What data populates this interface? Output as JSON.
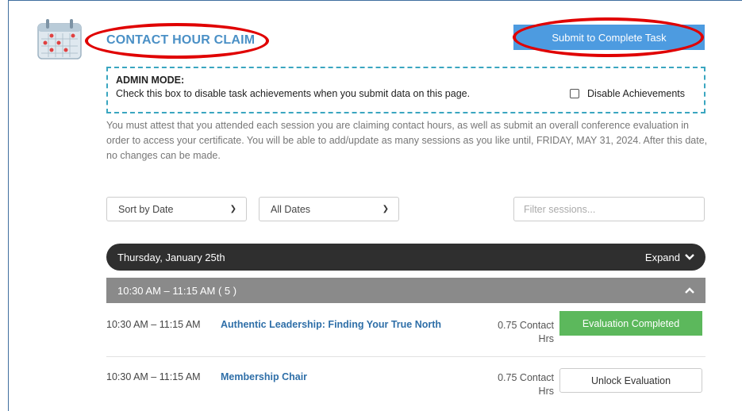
{
  "header": {
    "title": "CONTACT HOUR CLAIM",
    "submit_label": "Submit to Complete Task"
  },
  "admin": {
    "title": "ADMIN MODE:",
    "instruction": "Check this box to disable task achievements when you submit data on this page.",
    "checkbox_label": "Disable Achievements",
    "checked": false
  },
  "notice": "You must attest that you attended each session you are claiming contact hours, as well as submit an overall conference evaluation in order to access your certificate. You will be able to add/update as many sessions as you like until, FRIDAY, MAY 31, 2024. After this date, no changes can be made.",
  "filters": {
    "sort_selected": "Sort by Date",
    "date_selected": "All Dates",
    "search_placeholder": "Filter sessions..."
  },
  "day_group": {
    "label": "Thursday, January 25th",
    "toggle_label": "Expand"
  },
  "time_group": {
    "label": "10:30 AM – 11:15 AM   ( 5 )"
  },
  "sessions": [
    {
      "time": "10:30 AM – 11:15 AM",
      "title": "Authentic Leadership: Finding Your True North",
      "hours_line1": "0.75 Contact",
      "hours_line2": "Hrs",
      "action": "Evaluation Completed"
    },
    {
      "time": "10:30 AM – 11:15 AM",
      "title": "Membership Chair",
      "hours_line1": "0.75 Contact",
      "hours_line2": "Hrs",
      "action": "Unlock Evaluation"
    }
  ],
  "colors": {
    "accent": "#4d9be0",
    "title": "#4a90c6",
    "success": "#5cb85c",
    "annotation": "#e00000"
  }
}
